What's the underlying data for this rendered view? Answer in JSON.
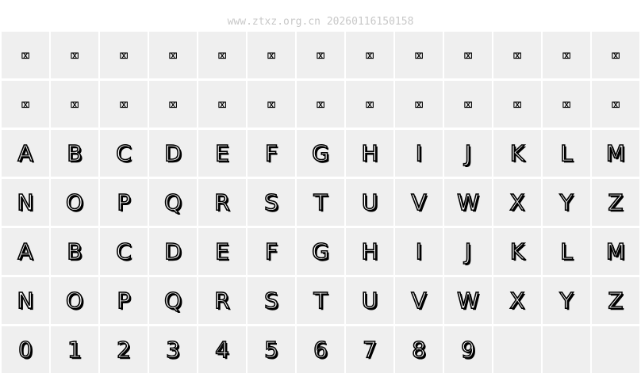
{
  "watermark": "www.ztxz.org.cn 20260116150158",
  "rows": [
    [
      "⌧",
      "⌧",
      "⌧",
      "⌧",
      "⌧",
      "⌧",
      "⌧",
      "⌧",
      "⌧",
      "⌧",
      "⌧",
      "⌧",
      "⌧"
    ],
    [
      "⌧",
      "⌧",
      "⌧",
      "⌧",
      "⌧",
      "⌧",
      "⌧",
      "⌧",
      "⌧",
      "⌧",
      "⌧",
      "⌧",
      "⌧"
    ],
    [
      "A",
      "B",
      "C",
      "D",
      "E",
      "F",
      "G",
      "H",
      "I",
      "J",
      "K",
      "L",
      "M"
    ],
    [
      "N",
      "O",
      "P",
      "Q",
      "R",
      "S",
      "T",
      "U",
      "V",
      "W",
      "X",
      "Y",
      "Z"
    ],
    [
      "A",
      "B",
      "C",
      "D",
      "E",
      "F",
      "G",
      "H",
      "I",
      "J",
      "K",
      "L",
      "M"
    ],
    [
      "N",
      "O",
      "P",
      "Q",
      "R",
      "S",
      "T",
      "U",
      "V",
      "W",
      "X",
      "Y",
      "Z"
    ],
    [
      "0",
      "1",
      "2",
      "3",
      "4",
      "5",
      "6",
      "7",
      "8",
      "9",
      "",
      "",
      " "
    ]
  ]
}
